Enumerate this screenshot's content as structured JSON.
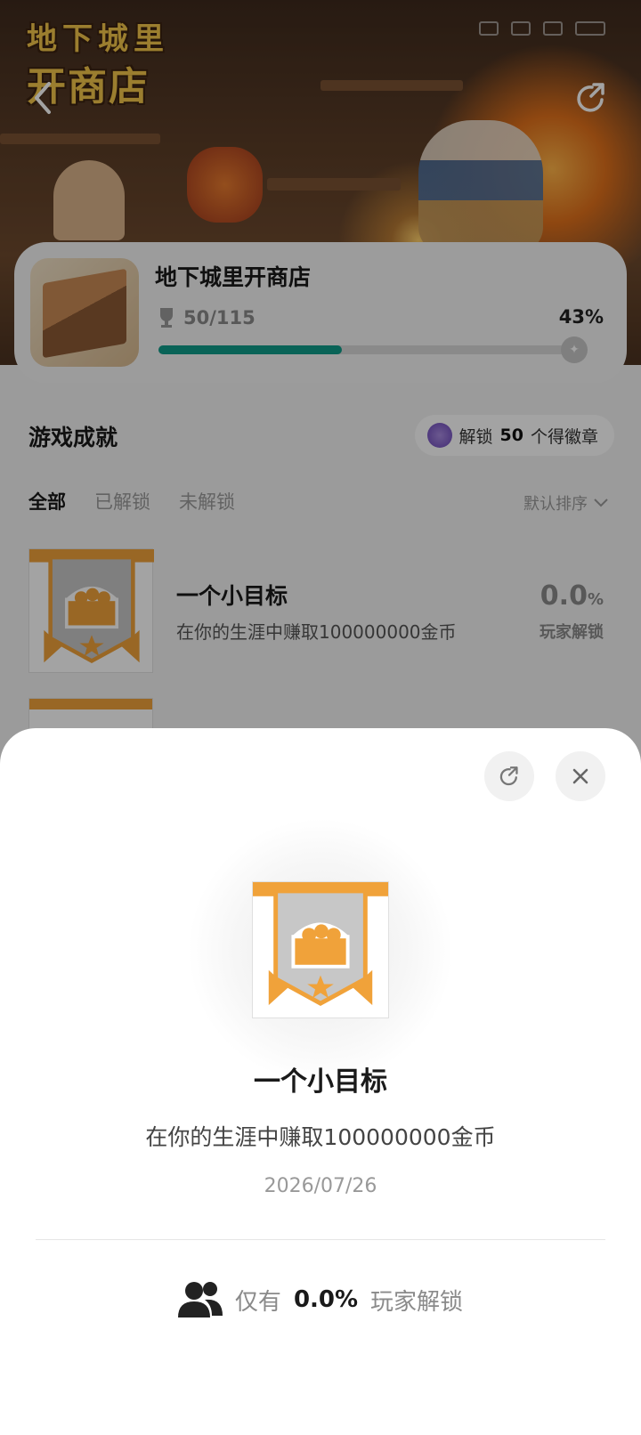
{
  "header": {
    "logo_line1": "地下城里",
    "logo_line2": "开商店",
    "back_icon": "chevron-left-icon",
    "share_icon": "share-icon"
  },
  "game_card": {
    "title": "地下城里开商店",
    "trophy_icon": "trophy-icon",
    "achievements_progress": "50/115",
    "percent_text": "43%",
    "progress": 0.43,
    "accent_color": "#0f9b89"
  },
  "section": {
    "title": "游戏成就",
    "badge_prefix": "解锁 ",
    "badge_count": "50",
    "badge_suffix": " 个得徽章"
  },
  "tabs": [
    {
      "label": "全部",
      "active": true
    },
    {
      "label": "已解锁",
      "active": false
    },
    {
      "label": "未解锁",
      "active": false
    }
  ],
  "sort_label": "默认排序",
  "list": [
    {
      "name": "一个小目标",
      "desc": "在你的生涯中赚取100000000金币",
      "pct_num": "0.0",
      "pct_unit": "%",
      "pct_label": "玩家解锁"
    }
  ],
  "sheet": {
    "share_icon": "share-icon",
    "close_icon": "close-icon",
    "title": "一个小目标",
    "desc": "在你的生涯中赚取100000000金币",
    "date": "2026/07/26",
    "users_icon": "users-icon",
    "stat_prefix": "仅有",
    "stat_value": "0.0%",
    "stat_suffix": "玩家解锁"
  }
}
